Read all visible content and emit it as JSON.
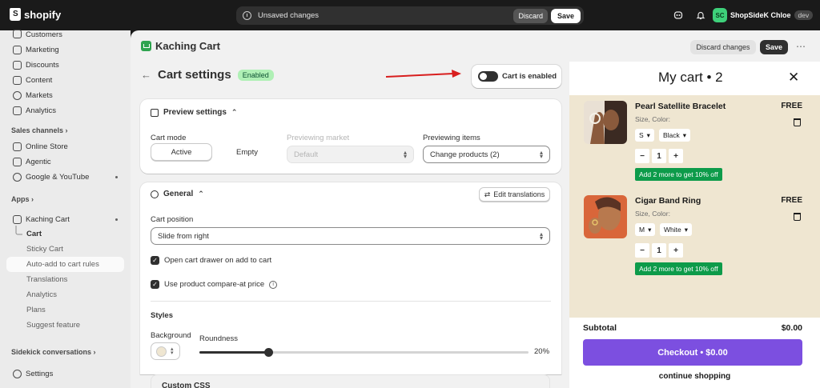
{
  "topbar": {
    "brand": "shopify",
    "unsaved_text": "Unsaved changes",
    "discard_label": "Discard",
    "save_label": "Save",
    "avatar_initials": "SC",
    "store_name": "ShopSideK Chloe",
    "env_badge": "dev"
  },
  "sidebar": {
    "items": [
      {
        "label": "Customers",
        "icon": "customers-icon"
      },
      {
        "label": "Marketing",
        "icon": "marketing-icon"
      },
      {
        "label": "Discounts",
        "icon": "discounts-icon"
      },
      {
        "label": "Content",
        "icon": "content-icon"
      },
      {
        "label": "Markets",
        "icon": "markets-icon"
      },
      {
        "label": "Analytics",
        "icon": "analytics-icon"
      }
    ],
    "sales_channels_label": "Sales channels",
    "channels": [
      {
        "label": "Online Store"
      },
      {
        "label": "Agentic"
      },
      {
        "label": "Google & YouTube"
      }
    ],
    "apps_label": "Apps",
    "app_name": "Kaching Cart",
    "app_subitems": [
      "Cart",
      "Sticky Cart",
      "Auto-add to cart rules",
      "Translations",
      "Analytics",
      "Plans",
      "Suggest feature"
    ],
    "sidekick_label": "Sidekick conversations",
    "settings_label": "Settings"
  },
  "app_header": {
    "app_name": "Kaching Cart",
    "discard_changes_label": "Discard changes",
    "save_label": "Save",
    "more_label": "⋯"
  },
  "page": {
    "title": "Cart settings",
    "status_badge": "Enabled",
    "toggle_label": "Cart is enabled"
  },
  "preview": {
    "heading": "Preview settings",
    "cart_mode_label": "Cart mode",
    "mode_active": "Active",
    "mode_empty": "Empty",
    "market_label": "Previewing market",
    "market_value": "Default",
    "items_label": "Previewing items",
    "items_value": "Change products (2)"
  },
  "general": {
    "heading": "General",
    "edit_translations_label": "Edit translations",
    "cart_position_label": "Cart position",
    "cart_position_value": "Slide from right",
    "open_drawer_label": "Open cart drawer on add to cart",
    "compare_price_label": "Use product compare-at price",
    "styles_label": "Styles",
    "background_label": "Background",
    "roundness_label": "Roundness",
    "roundness_value": "20%",
    "roundness_fraction": 0.21,
    "custom_css_label": "Custom CSS"
  },
  "cart": {
    "title": "My cart • 2",
    "items": [
      {
        "name": "Pearl Satellite Bracelet",
        "price": "FREE",
        "variant_label": "Size, Color:",
        "size": "S",
        "color": "Black",
        "qty": "1",
        "promo": "Add 2 more to get 10% off"
      },
      {
        "name": "Cigar Band Ring",
        "price": "FREE",
        "variant_label": "Size, Color:",
        "size": "M",
        "color": "White",
        "qty": "1",
        "promo": "Add 2 more to get 10% off"
      }
    ],
    "subtotal_label": "Subtotal",
    "subtotal_value": "$0.00",
    "checkout_label": "Checkout • $0.00",
    "continue_label": "continue shopping"
  },
  "colors": {
    "checkout": "#7c4fe0",
    "promo": "#0d9b4a",
    "panel_bg": "#efe6d1",
    "enabled_badge": "#aff0b5"
  }
}
